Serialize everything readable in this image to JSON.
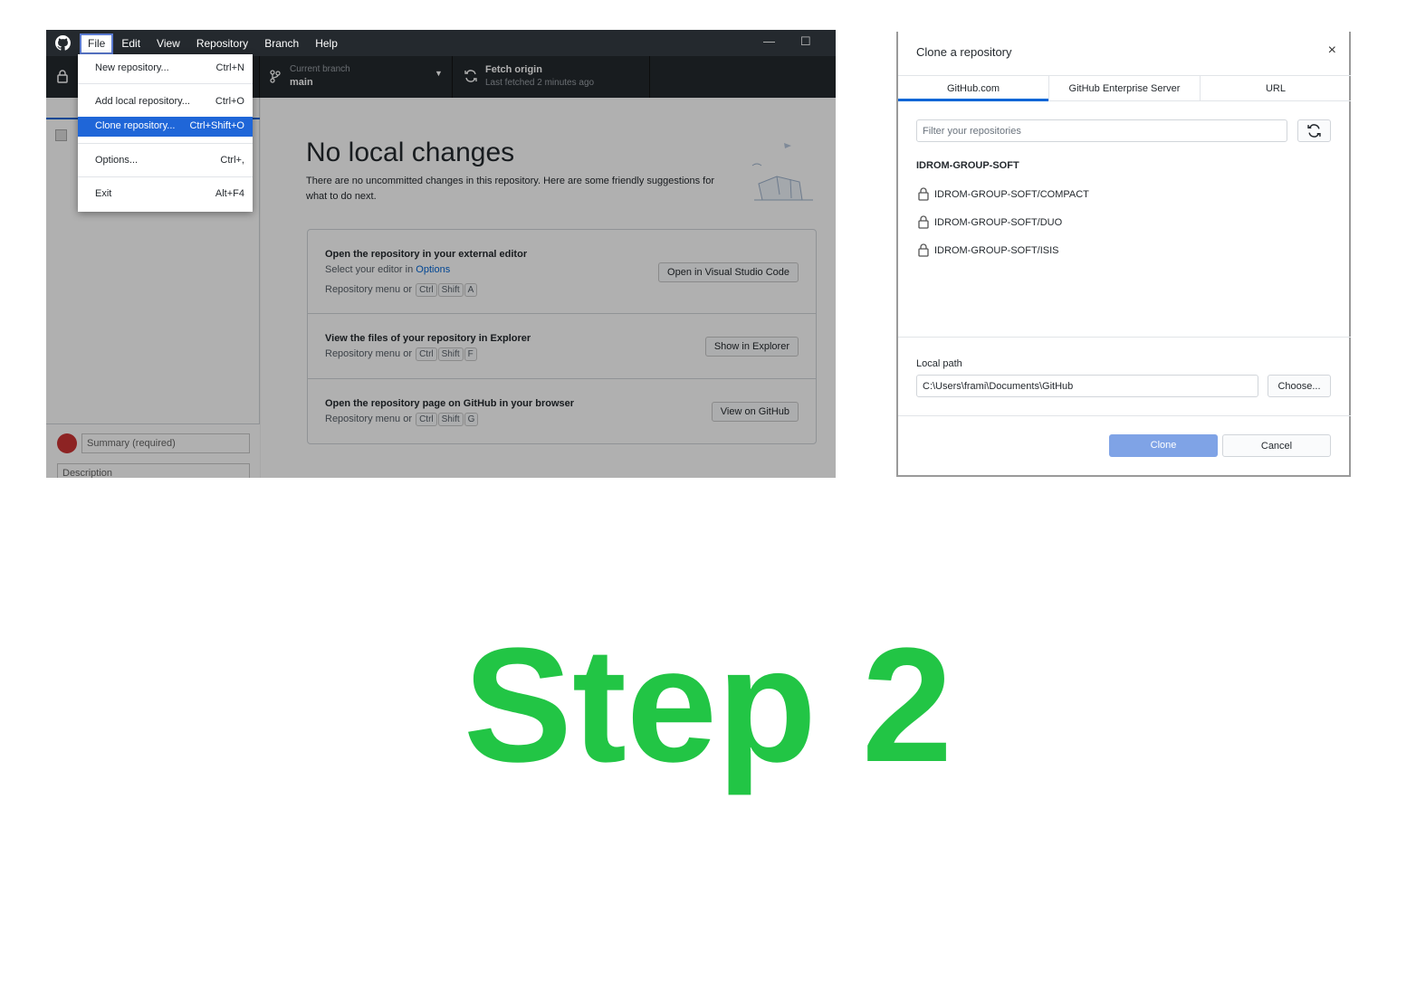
{
  "app": {
    "menu": [
      "File",
      "Edit",
      "View",
      "Repository",
      "Branch",
      "Help"
    ],
    "window_controls": {
      "minimize": "—",
      "maximize": "☐"
    },
    "toolbar": {
      "branch_label": "Current branch",
      "branch_name": "main",
      "fetch_title": "Fetch origin",
      "fetch_sub": "Last fetched 2 minutes ago"
    },
    "file_menu": [
      {
        "label": "New repository...",
        "shortcut": "Ctrl+N"
      },
      {
        "label": "Add local repository...",
        "shortcut": "Ctrl+O"
      },
      {
        "label": "Clone repository...",
        "shortcut": "Ctrl+Shift+O"
      },
      {
        "label": "Options...",
        "shortcut": "Ctrl+,"
      },
      {
        "label": "Exit",
        "shortcut": "Alt+F4"
      }
    ],
    "commit": {
      "summary_placeholder": "Summary (required)",
      "description_placeholder": "Description"
    },
    "main": {
      "title": "No local changes",
      "subtitle": "There are no uncommitted changes in this repository. Here are some friendly suggestions for what to do next.",
      "cards": [
        {
          "title": "Open the repository in your external editor",
          "line1_prefix": "Select your editor in ",
          "line1_link": "Options",
          "hint": "Repository menu or",
          "keys": [
            "Ctrl",
            "Shift",
            "A"
          ],
          "button": "Open in Visual Studio Code"
        },
        {
          "title": "View the files of your repository in Explorer",
          "hint": "Repository menu or",
          "keys": [
            "Ctrl",
            "Shift",
            "F"
          ],
          "button": "Show in Explorer"
        },
        {
          "title": "Open the repository page on GitHub in your browser",
          "hint": "Repository menu or",
          "keys": [
            "Ctrl",
            "Shift",
            "G"
          ],
          "button": "View on GitHub"
        }
      ]
    }
  },
  "dialog": {
    "title": "Clone a repository",
    "close": "×",
    "tabs": [
      "GitHub.com",
      "GitHub Enterprise Server",
      "URL"
    ],
    "active_tab": "GitHub.com",
    "filter_placeholder": "Filter your repositories",
    "org": "IDROM-GROUP-SOFT",
    "repos": [
      "IDROM-GROUP-SOFT/COMPACT",
      "IDROM-GROUP-SOFT/DUO",
      "IDROM-GROUP-SOFT/ISIS"
    ],
    "local_path_label": "Local path",
    "local_path_value": "C:\\Users\\frami\\Documents\\GitHub",
    "choose_label": "Choose...",
    "clone_label": "Clone",
    "cancel_label": "Cancel"
  },
  "caption": {
    "text": "Step 2",
    "color": "#22c545"
  },
  "colors": {
    "accent": "#0366d6",
    "menu_highlight": "#1f66d8",
    "titlebar": "#24292e"
  }
}
